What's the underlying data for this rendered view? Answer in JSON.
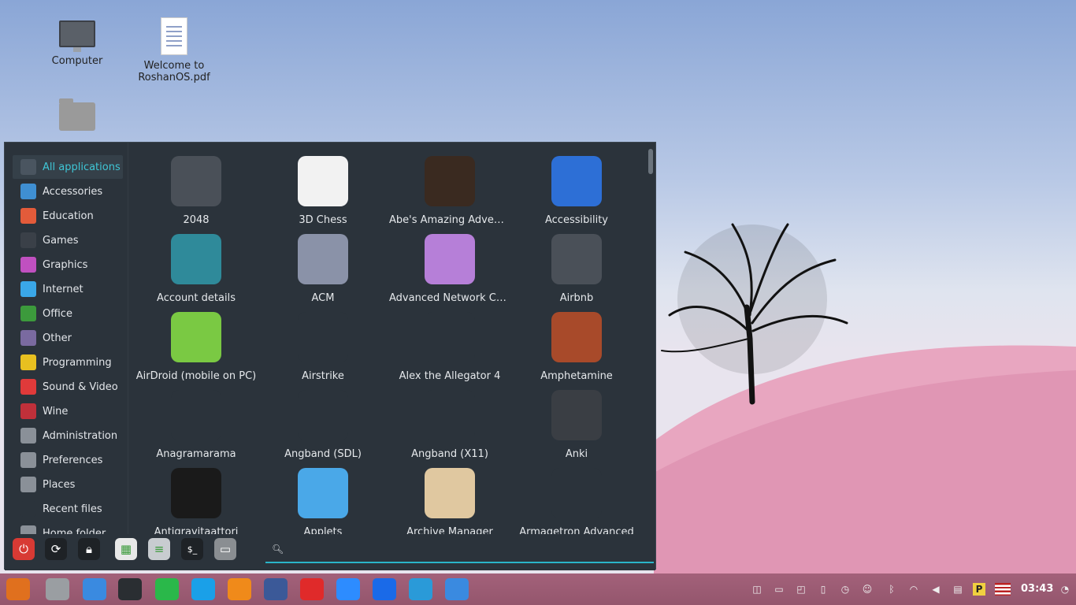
{
  "desktop": {
    "icons": [
      {
        "label": "Computer"
      },
      {
        "label": "Welcome to RoshanOS.pdf"
      },
      {
        "label": ""
      }
    ]
  },
  "menu": {
    "categories": [
      {
        "label": "All applications",
        "icon": "monitor-icon",
        "color": "#4a5560"
      },
      {
        "label": "Accessories",
        "icon": "scissors-icon",
        "color": "#3f8fd2"
      },
      {
        "label": "Education",
        "icon": "lifebuoy-icon",
        "color": "#e35b3a"
      },
      {
        "label": "Games",
        "icon": "invader-icon",
        "color": "#3a4048"
      },
      {
        "label": "Graphics",
        "icon": "palette-icon",
        "color": "#c050c0"
      },
      {
        "label": "Internet",
        "icon": "cloud-icon",
        "color": "#3aa7e8"
      },
      {
        "label": "Office",
        "icon": "document-icon",
        "color": "#3c9a3c"
      },
      {
        "label": "Other",
        "icon": "grid-icon",
        "color": "#7a6aa0"
      },
      {
        "label": "Programming",
        "icon": "code-icon",
        "color": "#e8c020"
      },
      {
        "label": "Sound & Video",
        "icon": "play-icon",
        "color": "#e03a3a"
      },
      {
        "label": "Wine",
        "icon": "wine-icon",
        "color": "#c0303a"
      },
      {
        "label": "Administration",
        "icon": "toggle-icon",
        "color": "#8a9098"
      },
      {
        "label": "Preferences",
        "icon": "settings-toggle-icon",
        "color": "#8a9098"
      },
      {
        "label": "Places",
        "icon": "folder-icon",
        "color": "#8a9098"
      },
      {
        "label": "Recent files",
        "icon": "clock-icon",
        "color": "#2b333b"
      },
      {
        "label": "Home folder",
        "icon": "home-folder-icon",
        "color": "#8a9098"
      }
    ],
    "apps": [
      {
        "label": "2048",
        "icon": "cloud-app-icon",
        "color": "#4a5058"
      },
      {
        "label": "3D Chess",
        "icon": "chess-icon",
        "color": "#f2f2f2"
      },
      {
        "label": "Abe's Amazing Adventure",
        "icon": "abe-icon",
        "color": "#3a2a20"
      },
      {
        "label": "Accessibility",
        "icon": "accessibility-icon",
        "color": "#2d6fd6"
      },
      {
        "label": "Account details",
        "icon": "user-icon",
        "color": "#2f8a9a"
      },
      {
        "label": "ACM",
        "icon": "jet-icon",
        "color": "#8a92a8"
      },
      {
        "label": "Advanced Network Co...",
        "icon": "network-arrows-icon",
        "color": "#b67fd8"
      },
      {
        "label": "Airbnb",
        "icon": "cloud-app-icon",
        "color": "#4a5058"
      },
      {
        "label": "AirDroid (mobile on PC)",
        "icon": "paper-plane-icon",
        "color": "#7ac943"
      },
      {
        "label": "Airstrike",
        "icon": "balloon-icon",
        "color": "#2b333b"
      },
      {
        "label": "Alex the Allegator 4",
        "icon": "alligator-icon",
        "color": "#2b333b"
      },
      {
        "label": "Amphetamine",
        "icon": "space-icon",
        "color": "#a84a2a"
      },
      {
        "label": "Anagramarama",
        "icon": "blank-icon",
        "color": "#2b333b"
      },
      {
        "label": "Angband (SDL)",
        "icon": "angband-icon",
        "color": "#2b333b"
      },
      {
        "label": "Angband (X11)",
        "icon": "angband-icon",
        "color": "#2b333b"
      },
      {
        "label": "Anki",
        "icon": "star-icon",
        "color": "#3a3e44"
      },
      {
        "label": "Antigravitaattori",
        "icon": "moon-icon",
        "color": "#1a1a1a"
      },
      {
        "label": "Applets",
        "icon": "dock-icon",
        "color": "#4aa8e8"
      },
      {
        "label": "Archive Manager",
        "icon": "archive-icon",
        "color": "#e0c8a0"
      },
      {
        "label": "Armagetron Advanced",
        "icon": "lightcycle-icon",
        "color": "#2b333b"
      }
    ],
    "bottom": {
      "buttons": [
        "power-icon",
        "restart-icon",
        "lock-icon",
        "apps-grid-icon",
        "settings-toggle-icon",
        "terminal-icon",
        "folder-icon"
      ],
      "search_placeholder": "",
      "search_value": ""
    }
  },
  "taskbar": {
    "launchers": [
      "menu-icon",
      "files-icon",
      "chromium-icon",
      "system-monitor-icon",
      "whatsapp-icon",
      "skype-icon",
      "media-player-icon",
      "facebook-icon",
      "youtube-icon",
      "zoom-icon",
      "teamviewer-icon",
      "kodi-icon",
      "document-viewer-icon"
    ],
    "clock": "03:43"
  }
}
